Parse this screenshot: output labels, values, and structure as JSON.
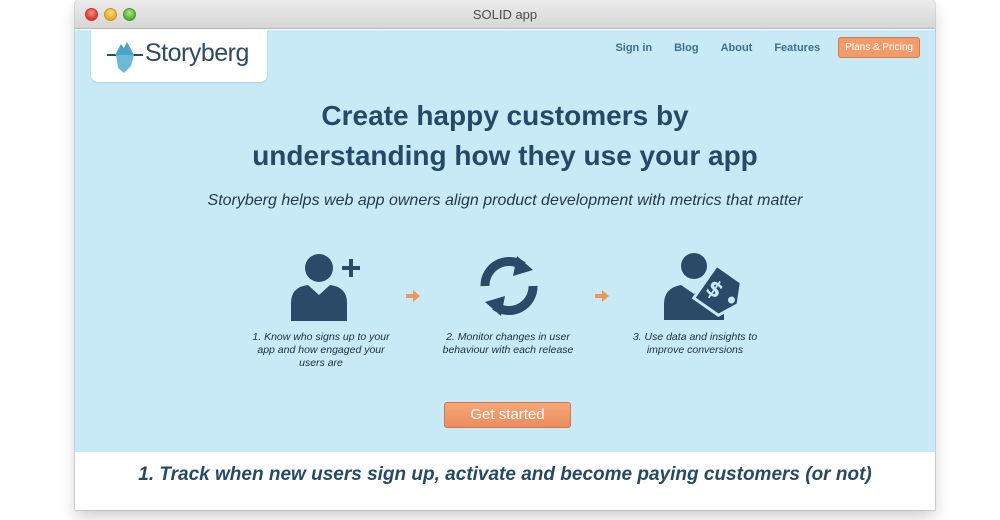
{
  "window": {
    "title": "SOLID app"
  },
  "logo": {
    "text": "Storyberg"
  },
  "nav": {
    "items": [
      {
        "label": "Sign in"
      },
      {
        "label": "Blog"
      },
      {
        "label": "About"
      },
      {
        "label": "Features"
      }
    ],
    "cta_label": "Plans & Pricing"
  },
  "hero": {
    "headline_line1": "Create happy customers by",
    "headline_line2": "understanding how they use your app",
    "subline": "Storyberg helps web app owners align product development with metrics that matter"
  },
  "steps": [
    {
      "icon": "add-user-icon",
      "text": "1. Know who signs up to your app and how engaged your users are"
    },
    {
      "icon": "refresh-cycle-icon",
      "text": "2. Monitor changes in user behaviour with each release"
    },
    {
      "icon": "user-price-tag-icon",
      "text": "3. Use data and insights to improve conversions"
    }
  ],
  "get_started_label": "Get started",
  "section": {
    "title": "1. Track when new users sign up, activate and become paying customers (or not)"
  },
  "colors": {
    "hero_bg": "#c7eaf6",
    "accent": "#f39c6b",
    "heading": "#264a66",
    "icon": "#2a4a67"
  }
}
